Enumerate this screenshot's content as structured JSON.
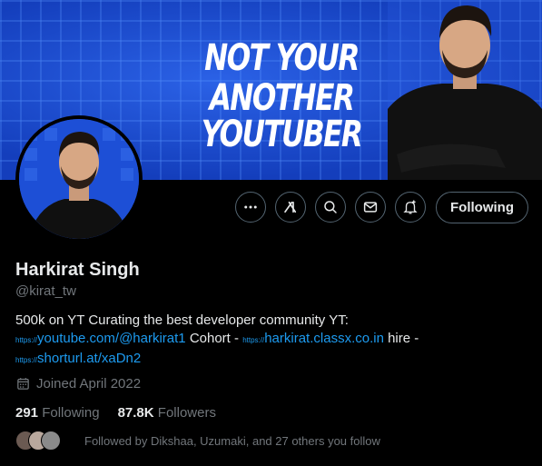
{
  "banner": {
    "line1": "NOT YOUR",
    "line2": "ANOTHER YOUTUBER"
  },
  "profile": {
    "name": "Harkirat Singh",
    "handle": "@kirat_tw",
    "bio_line1": "500k on YT Curating the best developer community YT:",
    "link_prefix": "https://",
    "link1": "youtube.com/@harkirat1",
    "text_cohort": " Cohort - ",
    "link2": "harkirat.classx.co.in",
    "text_hire": " hire -",
    "link3": "shorturl.at/xaDn2",
    "joined": "Joined April 2022"
  },
  "stats": {
    "following_count": "291",
    "following_label": "Following",
    "followers_count": "87.8K",
    "followers_label": "Followers"
  },
  "followed_by": "Followed by Dikshaa, Uzumaki, and 27 others you follow",
  "actions": {
    "follow_label": "Following",
    "icons": [
      "more-icon",
      "grok-icon",
      "search-icon",
      "message-icon",
      "notification-icon"
    ]
  },
  "colors": {
    "link": "#1d9bf0",
    "muted": "#71767b",
    "banner": "#1646c8"
  }
}
